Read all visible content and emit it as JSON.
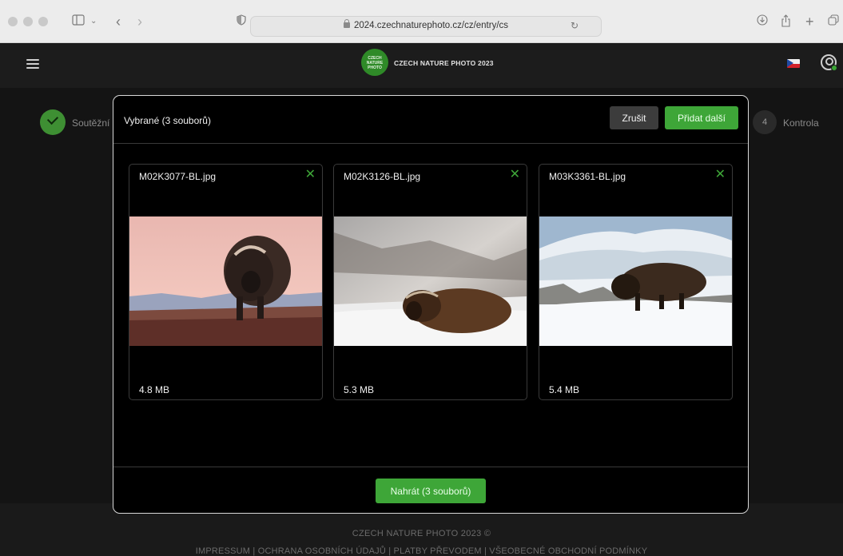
{
  "browser": {
    "url": "2024.czechnaturephoto.cz/cz/entry/cs"
  },
  "site": {
    "logo_badge_lines": [
      "CZECH",
      "NATURE",
      "PHOTO"
    ],
    "logo_text": "CZECH NATURE PHOTO 2023"
  },
  "steps": {
    "left_label": "Soutěžní",
    "right_number": "4",
    "right_label": "Kontrola"
  },
  "modal": {
    "title": "Vybrané (3 souborů)",
    "cancel_label": "Zrušit",
    "add_label": "Přidat další",
    "upload_label": "Nahrát (3 souborů)",
    "files": [
      {
        "name": "M02K3077-BL.jpg",
        "size": "4.8 MB"
      },
      {
        "name": "M02K3126-BL.jpg",
        "size": "5.3 MB"
      },
      {
        "name": "M03K3361-BL.jpg",
        "size": "5.4 MB"
      }
    ],
    "remove_glyph": "✕"
  },
  "footer": {
    "copyright": "CZECH NATURE PHOTO 2023 ©",
    "links": "IMPRESSUM | OCHRANA OSOBNÍCH ÚDAJŮ | PLATBY PŘEVODEM | VŠEOBECNÉ OBCHODNÍ PODMÍNKY"
  },
  "colors": {
    "accent_green": "#3ea638",
    "modal_bg": "#000000",
    "page_bg": "#141414"
  }
}
